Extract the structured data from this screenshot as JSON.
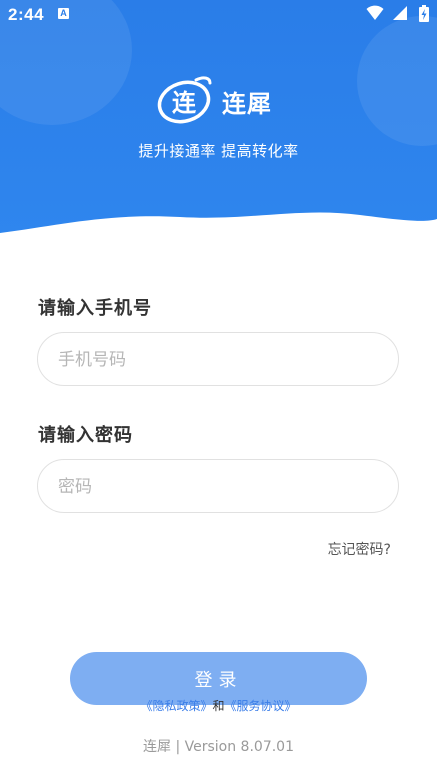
{
  "status_bar": {
    "time": "2:44",
    "notification_badge": "A",
    "icons": [
      "wifi-icon",
      "cellular-signal-icon",
      "battery-charging-icon"
    ]
  },
  "brand": {
    "logo_glyph": "连",
    "name": "连犀",
    "slogan": "提升接通率 提高转化率"
  },
  "form": {
    "phone_label": "请输入手机号",
    "phone_placeholder": "手机号码",
    "phone_value": "",
    "password_label": "请输入密码",
    "password_placeholder": "密码",
    "password_value": "",
    "forgot_password": "忘记密码?",
    "login_button": "登录"
  },
  "agreements": {
    "privacy_policy": "《隐私政策》",
    "conjunction": "和",
    "service_agreement": "《服务协议》"
  },
  "footer": {
    "version_text": "连犀 | Version 8.07.01"
  },
  "colors": {
    "header_blue": "#2a7de8",
    "button_disabled": "#7eaef2",
    "link_blue": "#3b7ee8"
  }
}
